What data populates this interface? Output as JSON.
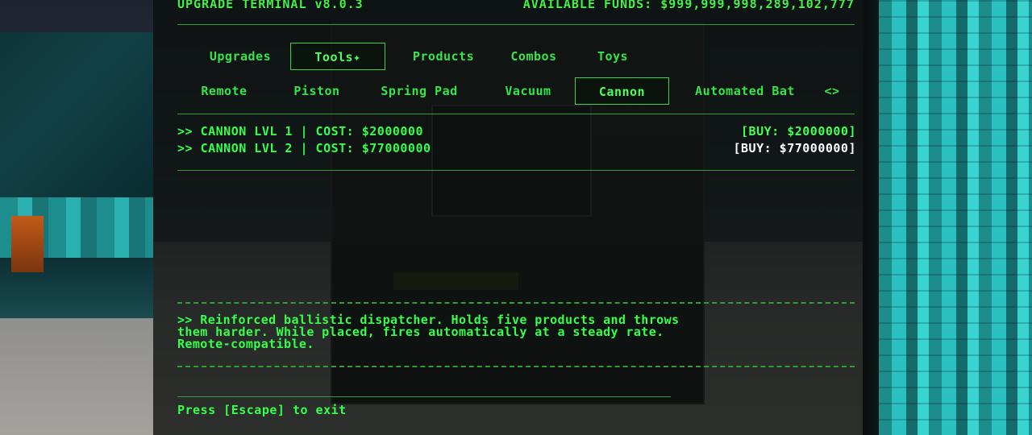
{
  "header": {
    "title": "UPGRADE TERMINAL v8.0.3",
    "funds_label": "AVAILABLE FUNDS:",
    "funds_value": "$999,999,998,289,102,777"
  },
  "category_tabs": [
    {
      "label": "Upgrades"
    },
    {
      "label": "Tools✦"
    },
    {
      "label": "Products"
    },
    {
      "label": "Combos"
    },
    {
      "label": "Toys"
    }
  ],
  "tool_tabs": [
    {
      "label": "Remote"
    },
    {
      "label": "Piston"
    },
    {
      "label": "Spring Pad"
    },
    {
      "label": "Vacuum"
    },
    {
      "label": "Cannon"
    },
    {
      "label": "Automated Bat"
    },
    {
      "label": "<>"
    }
  ],
  "items": [
    {
      "label": ">> CANNON LVL 1 | COST: $2000000",
      "buy": "[BUY: $2000000]"
    },
    {
      "label": ">> CANNON LVL 2 | COST: $77000000",
      "buy": "[BUY: $77000000]"
    }
  ],
  "description": {
    "line1": ">> Reinforced ballistic dispatcher. Holds five products and throws",
    "line2": "them harder. While placed, fires automatically at a steady rate.",
    "line3": "Remote-compatible."
  },
  "footer": {
    "exit_hint": "Press [Escape] to exit"
  },
  "colors": {
    "terminal_green": "#35ff4a",
    "rule_green": "#2f9e34",
    "selected_buy": "#ffffff"
  }
}
